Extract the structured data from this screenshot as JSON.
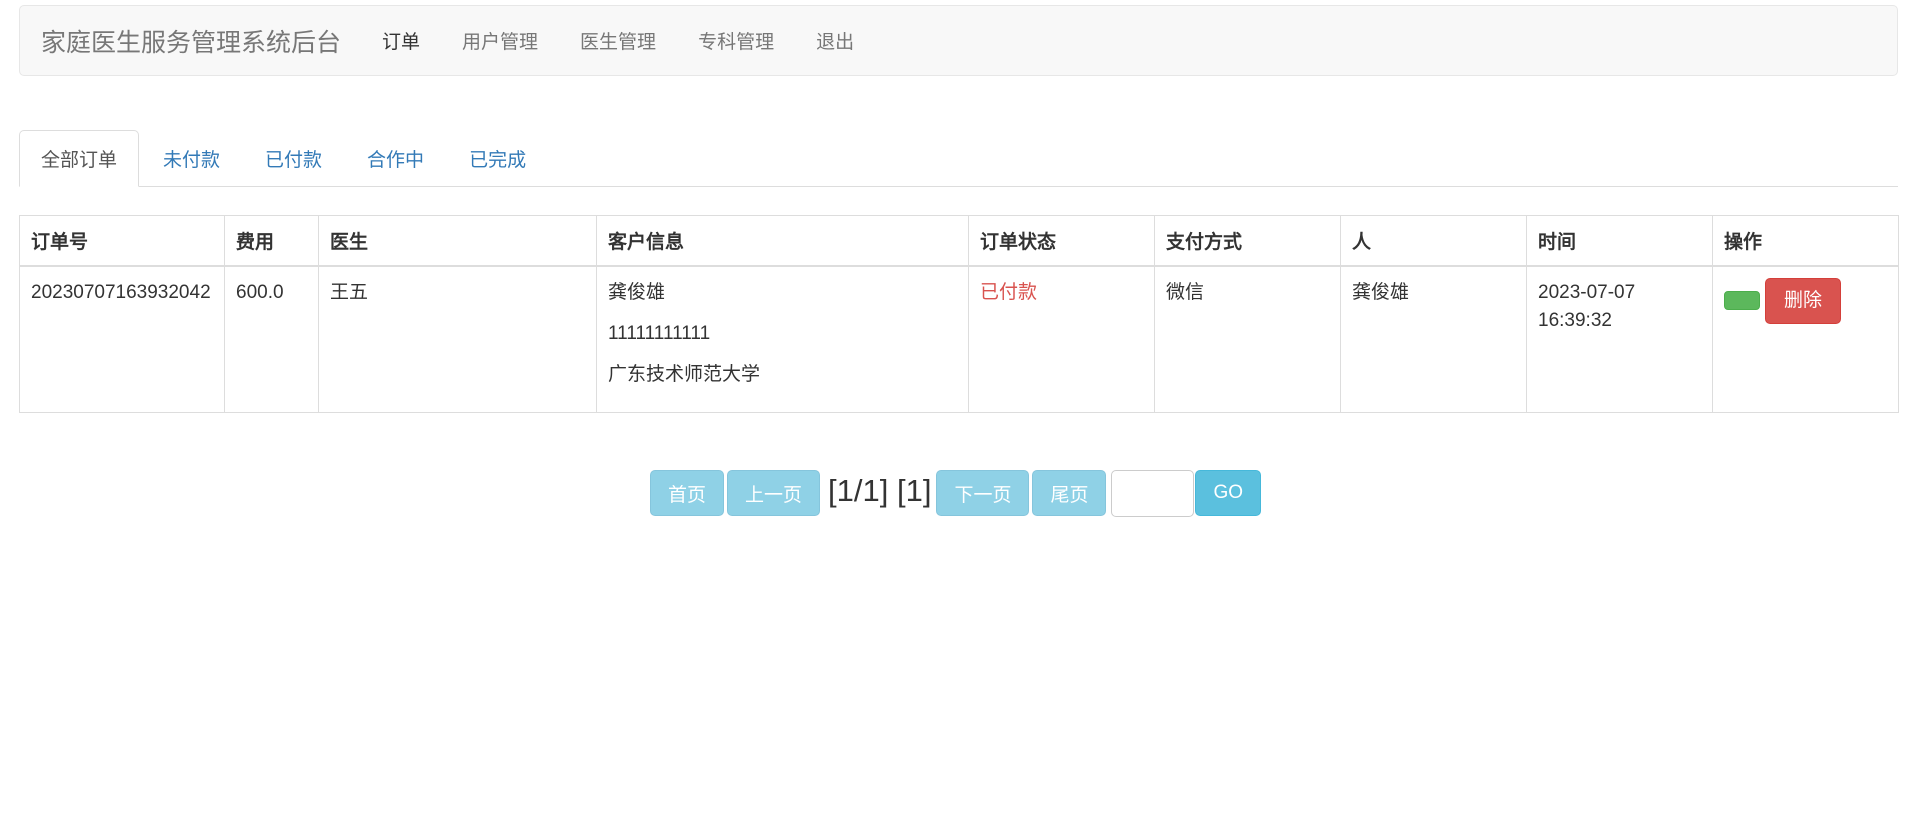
{
  "navbar": {
    "brand": "家庭医生服务管理系统后台",
    "items": [
      "订单",
      "用户管理",
      "医生管理",
      "专科管理",
      "退出"
    ]
  },
  "tabs": [
    "全部订单",
    "未付款",
    "已付款",
    "合作中",
    "已完成"
  ],
  "table": {
    "headers": [
      "订单号",
      "费用",
      "医生",
      "客户信息",
      "订单状态",
      "支付方式",
      "人",
      "时间",
      "操作"
    ],
    "rows": [
      {
        "order_no": "20230707163932042",
        "fee": "600.0",
        "doctor": "王五",
        "customer": {
          "name": "龚俊雄",
          "phone": "11111111111",
          "address": "广东技术师范大学"
        },
        "status": "已付款",
        "payment": "微信",
        "person": "龚俊雄",
        "time_date": "2023-07-07",
        "time_clock": "16:39:32",
        "delete_label": "删除"
      }
    ]
  },
  "pager": {
    "first": "首页",
    "prev": "上一页",
    "info": "[1/1] [1]",
    "next": "下一页",
    "last": "尾页",
    "input_value": "",
    "go": "GO"
  },
  "colors": {
    "status_paid": "#d9534f",
    "delete_button": "#d9534f",
    "green_button": "#5cb85c",
    "pager_button": "#8fd1e6",
    "go_button": "#5bc0de",
    "link": "#337ab7"
  }
}
